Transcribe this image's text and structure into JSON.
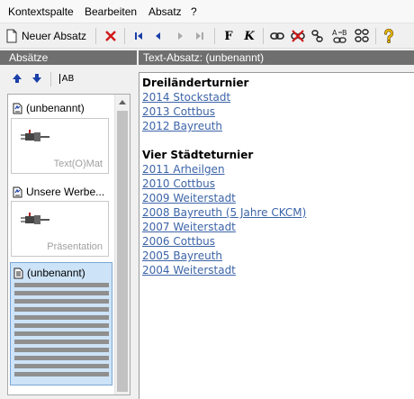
{
  "menu": {
    "items": [
      "Kontextspalte",
      "Bearbeiten",
      "Absatz",
      "?"
    ]
  },
  "toolbar": {
    "new_label": "Neuer Absatz",
    "bold_label": "F",
    "italic_label": "K"
  },
  "left": {
    "title": "Absätze",
    "format_label": "AB",
    "entries": [
      {
        "title": "(unbenannt)",
        "caption": "Text(O)Mat"
      },
      {
        "title": "Unsere Werbe...",
        "caption": "Präsentation"
      },
      {
        "title": "(unbenannt)"
      }
    ]
  },
  "right": {
    "title": "Text-Absatz: (unbenannt)",
    "sections": [
      {
        "heading": "Dreiländerturnier",
        "links": [
          "2014 Stockstadt",
          "2013 Cottbus",
          "2012 Bayreuth"
        ]
      },
      {
        "heading": "Vier Städteturnier",
        "links": [
          "2011 Arheilgen",
          "2010 Cottbus",
          "2009 Weiterstadt",
          "2008 Bayreuth (5 Jahre CKCM)",
          "2007 Weiterstadt",
          "2006 Cottbus",
          "2005 Bayreuth",
          "2004 Weiterstadt"
        ]
      }
    ]
  },
  "colors": {
    "header_bg": "#6f6f6f",
    "link": "#3c64a8",
    "delete_red": "#d01818",
    "nav_blue": "#1a3fa8",
    "selection_bg": "#cde3f7"
  }
}
